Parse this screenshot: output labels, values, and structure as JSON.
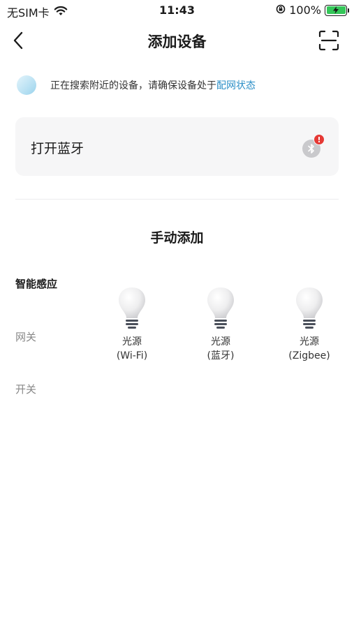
{
  "status_bar": {
    "carrier": "无SIM卡",
    "time": "11:43",
    "battery": "100%"
  },
  "nav": {
    "title": "添加设备"
  },
  "hint": {
    "text": "正在搜索附近的设备，请确保设备处于",
    "link": "配网状态"
  },
  "bluetooth": {
    "label": "打开蓝牙",
    "badge": "!"
  },
  "manual": {
    "title": "手动添加"
  },
  "categories": [
    {
      "label": "智能感应"
    },
    {
      "label": "网关"
    },
    {
      "label": "开关"
    }
  ],
  "devices": [
    {
      "name": "光源",
      "sub": "(Wi-Fi)",
      "icon": "light-bulb-icon"
    },
    {
      "name": "光源",
      "sub": "(蓝牙)",
      "icon": "light-bulb-icon"
    },
    {
      "name": "光源",
      "sub": "(Zigbee)",
      "icon": "light-bulb-icon"
    }
  ],
  "colors": {
    "link": "#2c8fc7",
    "card_bg": "#f6f6f7",
    "battery": "#34c759",
    "badge": "#e53935"
  }
}
